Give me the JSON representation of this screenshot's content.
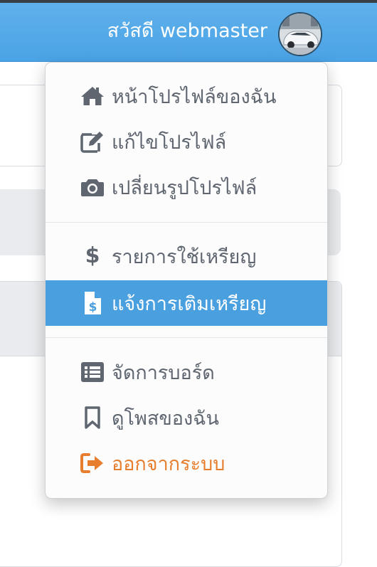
{
  "navbar": {
    "greeting": "สวัสดี webmaster",
    "avatar_alt": "user avatar (car photo)"
  },
  "menu": {
    "items": [
      {
        "label": "หน้าโปรไฟล์ของฉัน",
        "icon": "home-icon"
      },
      {
        "label": "แก้ไขโปรไฟล์",
        "icon": "edit-icon"
      },
      {
        "label": "เปลี่ยนรูปโปรไฟล์",
        "icon": "camera-icon"
      },
      {
        "label": "รายการใช้เหรียญ",
        "icon": "dollar-icon"
      },
      {
        "label": "แจ้งการเติมเหรียญ",
        "icon": "invoice-dollar-icon",
        "active": true
      },
      {
        "label": "จัดการบอร์ด",
        "icon": "list-icon"
      },
      {
        "label": "ดูโพสของฉัน",
        "icon": "bookmark-icon"
      },
      {
        "label": "ออกจากระบบ",
        "icon": "sign-out-icon"
      }
    ]
  },
  "colors": {
    "navbar": "#4aa3e6",
    "active_item": "#4a9fdf",
    "logout": "#e67e2e",
    "menu_text": "#5f6670"
  }
}
